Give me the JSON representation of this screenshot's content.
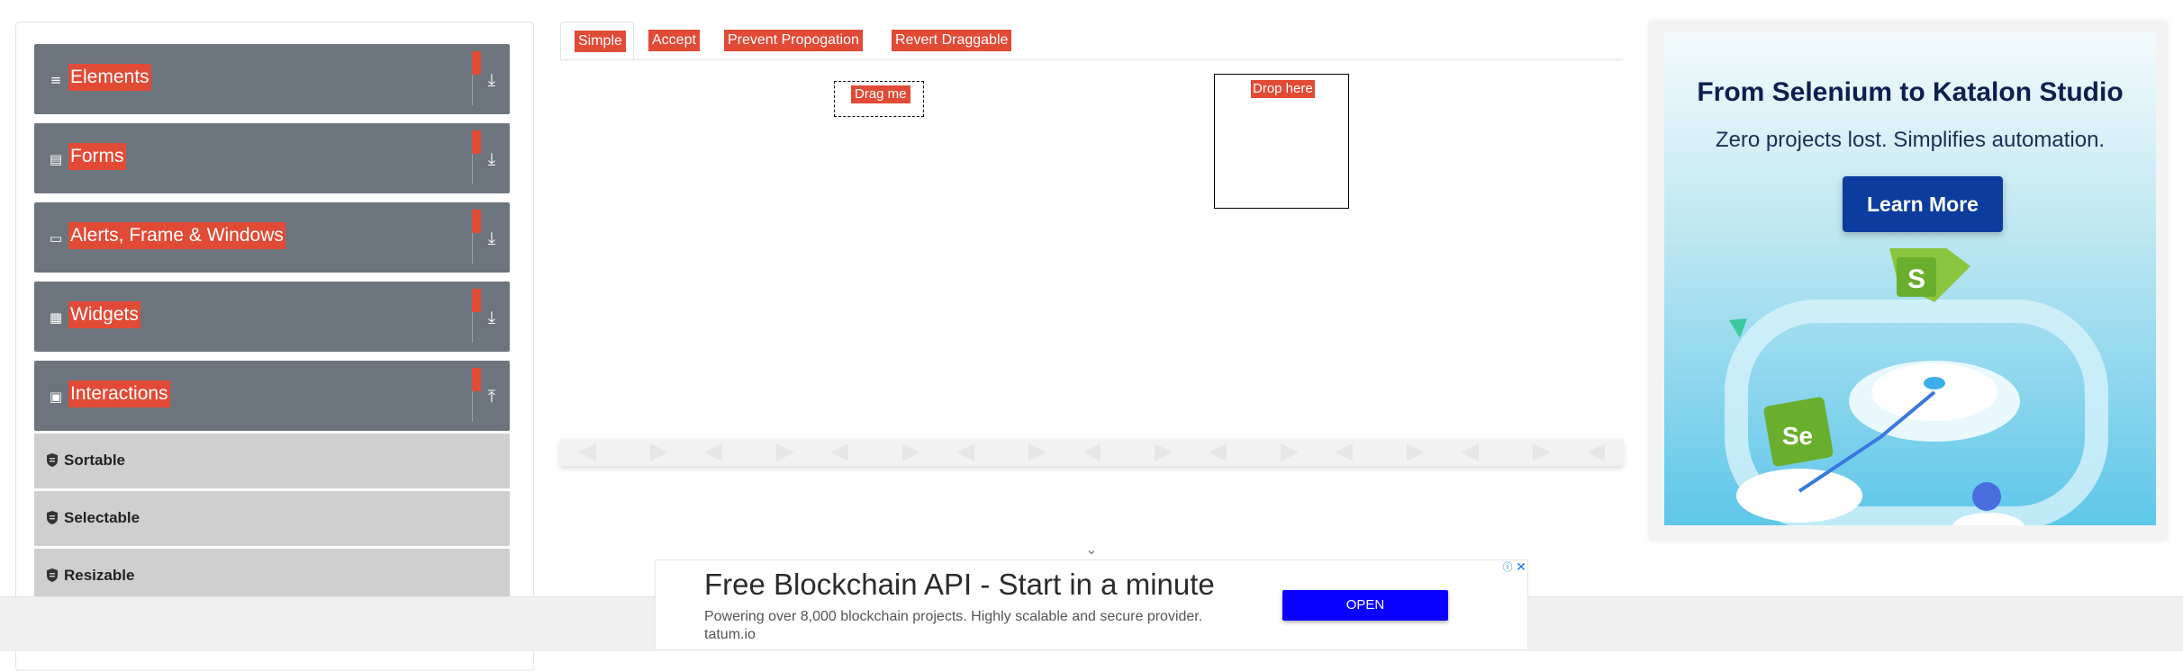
{
  "sidebar": {
    "groups": [
      {
        "label": "Elements",
        "icon": "hamburger-icon",
        "arrow": "download-arrow-icon"
      },
      {
        "label": "Forms",
        "icon": "document-icon",
        "arrow": "download-arrow-icon"
      },
      {
        "label": "Alerts, Frame & Windows",
        "icon": "window-icon",
        "arrow": "download-arrow-icon"
      },
      {
        "label": "Widgets",
        "icon": "grid-icon",
        "arrow": "download-arrow-icon"
      },
      {
        "label": "Interactions",
        "icon": "interactions-icon",
        "arrow": "upload-arrow-icon"
      }
    ],
    "interactions_items": [
      {
        "label": "Sortable"
      },
      {
        "label": "Selectable"
      },
      {
        "label": "Resizable"
      }
    ]
  },
  "tabs": [
    {
      "label": "Simple",
      "active": true
    },
    {
      "label": "Accept",
      "active": false
    },
    {
      "label": "Prevent Propogation",
      "active": false
    },
    {
      "label": "Revert Draggable",
      "active": false
    }
  ],
  "draggable": {
    "label": "Drag me"
  },
  "droppable": {
    "label": "Drop here"
  },
  "ad_right": {
    "headline": "From Selenium to Katalon Studio",
    "subhead": "Zero projects lost. Simplifies automation.",
    "cta": "Learn More"
  },
  "ad_bottom": {
    "title": "Free Blockchain API - Start in a minute",
    "description": "Powering over 8,000 blockchain projects. Highly scalable and secure provider.",
    "domain": "tatum.io",
    "cta": "OPEN"
  },
  "colors": {
    "highlight": "#e14a35",
    "sidebar_header": "#6c757d",
    "sub_item": "#cfcfcf",
    "ad_button": "#0c3c9e",
    "open_button": "#0a00ff"
  }
}
